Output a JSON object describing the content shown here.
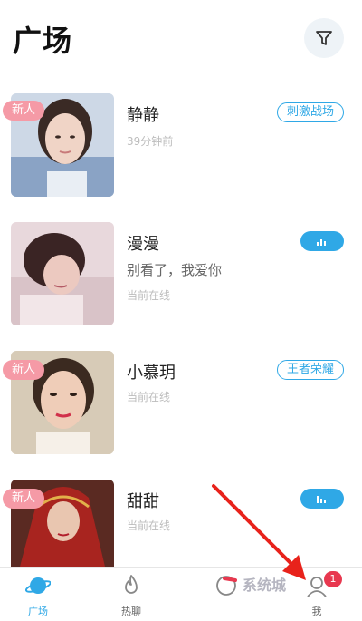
{
  "header": {
    "title": "广场"
  },
  "icons": {
    "filter": "filter-icon"
  },
  "colors": {
    "accent": "#2fa8e6",
    "new_badge": "#f59aa6",
    "notification": "#e8384f",
    "annotation_arrow": "#e8221b"
  },
  "cards": [
    {
      "name": "静静",
      "new_badge": "新人",
      "tag": "刺激战场",
      "subtitle": "39分钟前"
    },
    {
      "name": "漫漫",
      "voice_tag": "voice-wave-icon",
      "message": "别看了，我爱你",
      "subtitle": "当前在线"
    },
    {
      "name": "小慕玥",
      "new_badge": "新人",
      "tag": "王者荣耀",
      "subtitle": "当前在线"
    },
    {
      "name": "甜甜",
      "new_badge": "新人",
      "voice_tag": "voice-wave-icon",
      "subtitle": "当前在线"
    }
  ],
  "tabbar": {
    "tabs": [
      {
        "label": "广场",
        "icon": "planet-icon",
        "active": true
      },
      {
        "label": "热聊",
        "icon": "flame-icon",
        "active": false
      },
      {
        "label": "",
        "icon": "message-icon",
        "active": false
      },
      {
        "label": "",
        "icon": "group-icon",
        "active": false
      },
      {
        "label": "我",
        "icon": "profile-icon",
        "active": false,
        "badge": "1"
      }
    ]
  },
  "watermark": "系统城"
}
